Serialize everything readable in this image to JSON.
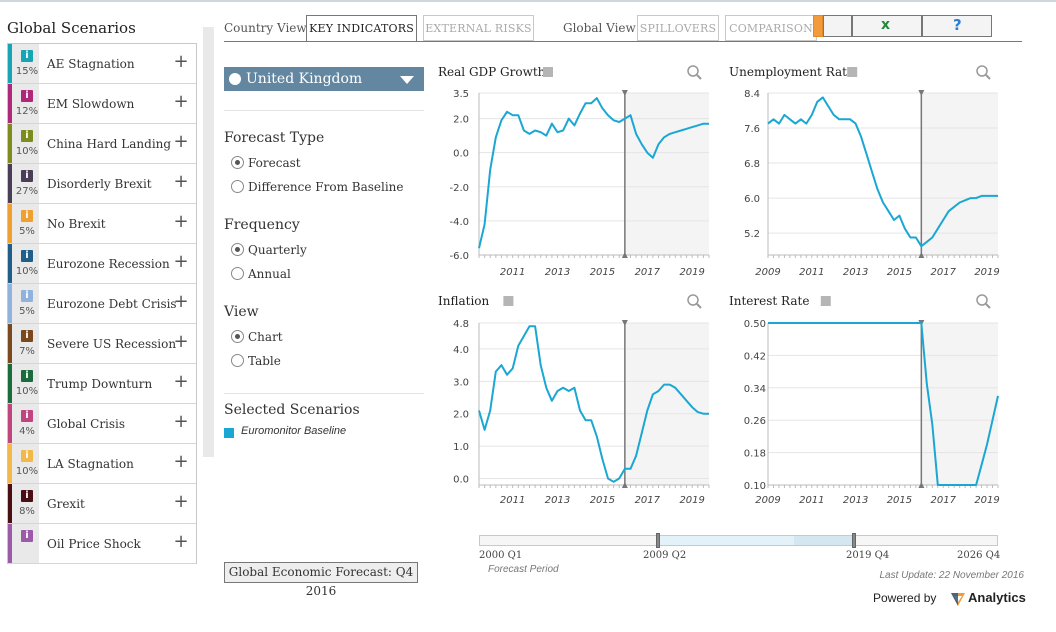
{
  "sidebar": {
    "title": "Global Scenarios",
    "items": [
      {
        "label": "AE Stagnation",
        "pct": "15%",
        "color": "#17a5b5"
      },
      {
        "label": "EM Slowdown",
        "pct": "12%",
        "color": "#b0287a"
      },
      {
        "label": "China Hard Landing",
        "pct": "10%",
        "color": "#7d8c1c"
      },
      {
        "label": "Disorderly Brexit",
        "pct": "27%",
        "color": "#4a3d55"
      },
      {
        "label": "No Brexit",
        "pct": "5%",
        "color": "#f0a030"
      },
      {
        "label": "Eurozone Recession",
        "pct": "10%",
        "color": "#1f5f8a"
      },
      {
        "label": "Eurozone Debt Crisis",
        "pct": "5%",
        "color": "#8fb3dc"
      },
      {
        "label": "Severe US Recession",
        "pct": "7%",
        "color": "#7a4a1e"
      },
      {
        "label": "Trump Downturn",
        "pct": "10%",
        "color": "#1c6b3c"
      },
      {
        "label": "Global Crisis",
        "pct": "4%",
        "color": "#c0457e"
      },
      {
        "label": "LA Stagnation",
        "pct": "10%",
        "color": "#f2b84a"
      },
      {
        "label": "Grexit",
        "pct": "8%",
        "color": "#4a0f15"
      },
      {
        "label": "Oil Price Shock",
        "pct": "",
        "color": "#9b5ba8"
      }
    ],
    "plus_glyph": "+",
    "info_glyph": "i"
  },
  "tabs": {
    "country_view": "Country View",
    "key_indicators": "KEY INDICATORS",
    "external_risks": "EXTERNAL RISKS",
    "global_view": "Global View",
    "spillovers": "SPILLOVERS",
    "comparison": "COMPARISON"
  },
  "toolbar": {
    "excel_icon": "excel-icon",
    "excel_glyph": "x",
    "help_glyph": "?"
  },
  "controls": {
    "country": "United Kingdom",
    "forecast_type": {
      "title": "Forecast Type",
      "options": [
        "Forecast",
        "Difference From Baseline"
      ],
      "selected": 0
    },
    "frequency": {
      "title": "Frequency",
      "options": [
        "Quarterly",
        "Annual"
      ],
      "selected": 0
    },
    "view": {
      "title": "View",
      "options": [
        "Chart",
        "Table"
      ],
      "selected": 0
    },
    "selected_scenarios_title": "Selected Scenarios",
    "selected_scenario": "Euromonitor Baseline",
    "selected_color": "#1aa7d3",
    "forecast_button": "Global Economic Forecast: Q4 2016"
  },
  "chart_data": [
    {
      "type": "line",
      "title": "Real GDP Growth",
      "ylim": [
        -6.0,
        3.5
      ],
      "yticks": [
        "3.5",
        "2.0",
        "0.0",
        "-2.0",
        "-4.0",
        "-6.0"
      ],
      "ytick_values": [
        3.5,
        2.0,
        0.0,
        -2.0,
        -4.0,
        -6.0
      ],
      "xlim": [
        2009.5,
        2019.75
      ],
      "xticks": [
        "2011",
        "2013",
        "2015",
        "2017",
        "2019"
      ],
      "forecast_start": 2016.0,
      "series": [
        {
          "x": [
            2009.5,
            2009.75,
            2010.0,
            2010.25,
            2010.5,
            2010.75,
            2011.0,
            2011.25,
            2011.5,
            2011.75,
            2012.0,
            2012.25,
            2012.5,
            2012.75,
            2013.0,
            2013.25,
            2013.5,
            2013.75,
            2014.0,
            2014.25,
            2014.5,
            2014.75,
            2015.0,
            2015.25,
            2015.5,
            2015.75,
            2016.0,
            2016.25,
            2016.5,
            2016.75,
            2017.0,
            2017.25,
            2017.5,
            2017.75,
            2018.0,
            2018.25,
            2018.5,
            2018.75,
            2019.0,
            2019.25,
            2019.5,
            2019.75
          ],
          "y": [
            -5.6,
            -4.2,
            -1.0,
            0.9,
            1.9,
            2.4,
            2.2,
            2.2,
            1.3,
            1.1,
            1.3,
            1.2,
            1.0,
            1.7,
            1.2,
            1.3,
            2.0,
            1.6,
            2.3,
            2.9,
            2.9,
            3.2,
            2.6,
            2.2,
            1.9,
            1.8,
            2.0,
            2.2,
            1.1,
            0.5,
            0.0,
            -0.3,
            0.5,
            0.9,
            1.1,
            1.2,
            1.3,
            1.4,
            1.5,
            1.6,
            1.7,
            1.7
          ]
        }
      ]
    },
    {
      "type": "line",
      "title": "Unemployment Rate",
      "ylim": [
        4.7,
        8.4
      ],
      "yticks": [
        "8.4",
        "7.6",
        "6.8",
        "6.0",
        "5.2"
      ],
      "ytick_values": [
        8.4,
        7.6,
        6.8,
        6.0,
        5.2
      ],
      "xlim": [
        2009.0,
        2019.5
      ],
      "xticks": [
        "2009",
        "2011",
        "2013",
        "2015",
        "2017",
        "2019"
      ],
      "forecast_start": 2016.0,
      "series": [
        {
          "x": [
            2009.0,
            2009.25,
            2009.5,
            2009.75,
            2010.0,
            2010.25,
            2010.5,
            2010.75,
            2011.0,
            2011.25,
            2011.5,
            2011.75,
            2012.0,
            2012.25,
            2012.5,
            2012.75,
            2013.0,
            2013.25,
            2013.5,
            2013.75,
            2014.0,
            2014.25,
            2014.5,
            2014.75,
            2015.0,
            2015.25,
            2015.5,
            2015.75,
            2016.0,
            2016.25,
            2016.5,
            2016.75,
            2017.0,
            2017.25,
            2017.5,
            2017.75,
            2018.0,
            2018.25,
            2018.5,
            2018.75,
            2019.0,
            2019.25,
            2019.5
          ],
          "y": [
            7.7,
            7.8,
            7.7,
            7.9,
            7.8,
            7.7,
            7.8,
            7.7,
            7.9,
            8.2,
            8.3,
            8.1,
            7.9,
            7.8,
            7.8,
            7.8,
            7.7,
            7.4,
            7.0,
            6.6,
            6.2,
            5.9,
            5.7,
            5.5,
            5.6,
            5.3,
            5.1,
            5.1,
            4.9,
            5.0,
            5.1,
            5.3,
            5.5,
            5.7,
            5.8,
            5.9,
            5.95,
            6.0,
            6.0,
            6.05,
            6.05,
            6.05,
            6.05
          ]
        }
      ]
    },
    {
      "type": "line",
      "title": "Inflation",
      "ylim": [
        -0.2,
        4.8
      ],
      "yticks": [
        "4.8",
        "4.0",
        "3.0",
        "2.0",
        "1.0",
        "0.0"
      ],
      "ytick_values": [
        4.8,
        4.0,
        3.0,
        2.0,
        1.0,
        0.0
      ],
      "xlim": [
        2009.5,
        2019.75
      ],
      "xticks": [
        "2011",
        "2013",
        "2015",
        "2017",
        "2019"
      ],
      "forecast_start": 2016.0,
      "series": [
        {
          "x": [
            2009.5,
            2009.75,
            2010.0,
            2010.25,
            2010.5,
            2010.75,
            2011.0,
            2011.25,
            2011.5,
            2011.75,
            2012.0,
            2012.25,
            2012.5,
            2012.75,
            2013.0,
            2013.25,
            2013.5,
            2013.75,
            2014.0,
            2014.25,
            2014.5,
            2014.75,
            2015.0,
            2015.25,
            2015.5,
            2015.75,
            2016.0,
            2016.25,
            2016.5,
            2016.75,
            2017.0,
            2017.25,
            2017.5,
            2017.75,
            2018.0,
            2018.25,
            2018.5,
            2018.75,
            2019.0,
            2019.25,
            2019.5,
            2019.75
          ],
          "y": [
            2.1,
            1.5,
            2.1,
            3.3,
            3.5,
            3.2,
            3.4,
            4.1,
            4.4,
            4.7,
            4.7,
            3.5,
            2.8,
            2.4,
            2.7,
            2.8,
            2.7,
            2.8,
            2.1,
            1.8,
            1.8,
            1.3,
            0.6,
            0.0,
            -0.1,
            0.0,
            0.3,
            0.3,
            0.7,
            1.4,
            2.1,
            2.6,
            2.7,
            2.9,
            2.9,
            2.8,
            2.6,
            2.4,
            2.2,
            2.05,
            2.0,
            2.0
          ]
        }
      ]
    },
    {
      "type": "line",
      "title": "Interest Rate",
      "ylim": [
        0.1,
        0.5
      ],
      "yticks": [
        "0.50",
        "0.42",
        "0.34",
        "0.26",
        "0.18",
        "0.10"
      ],
      "ytick_values": [
        0.5,
        0.42,
        0.34,
        0.26,
        0.18,
        0.1
      ],
      "xlim": [
        2009.0,
        2019.5
      ],
      "xticks": [
        "2009",
        "2011",
        "2013",
        "2015",
        "2017",
        "2019"
      ],
      "forecast_start": 2016.0,
      "series": [
        {
          "x": [
            2009.0,
            2016.0,
            2016.25,
            2016.5,
            2016.75,
            2017.0,
            2017.5,
            2018.0,
            2018.5,
            2018.75,
            2019.0,
            2019.25,
            2019.5
          ],
          "y": [
            0.5,
            0.5,
            0.35,
            0.25,
            0.1,
            0.1,
            0.1,
            0.1,
            0.1,
            0.15,
            0.2,
            0.26,
            0.32
          ]
        }
      ]
    }
  ],
  "line_color": "#1aa7d3",
  "timeline": {
    "start": "2000 Q1",
    "range_start": "2009 Q2",
    "range_end": "2019 Q4",
    "end": "2026 Q4",
    "forecast_period": "Forecast Period",
    "range_start_fraction": 0.347,
    "range_end_fraction": 0.722,
    "forecast_start_fraction": 0.607
  },
  "footer": {
    "last_update": "Last Update: 22 November 2016",
    "powered_by": "Powered by",
    "brand": "Analytics"
  }
}
